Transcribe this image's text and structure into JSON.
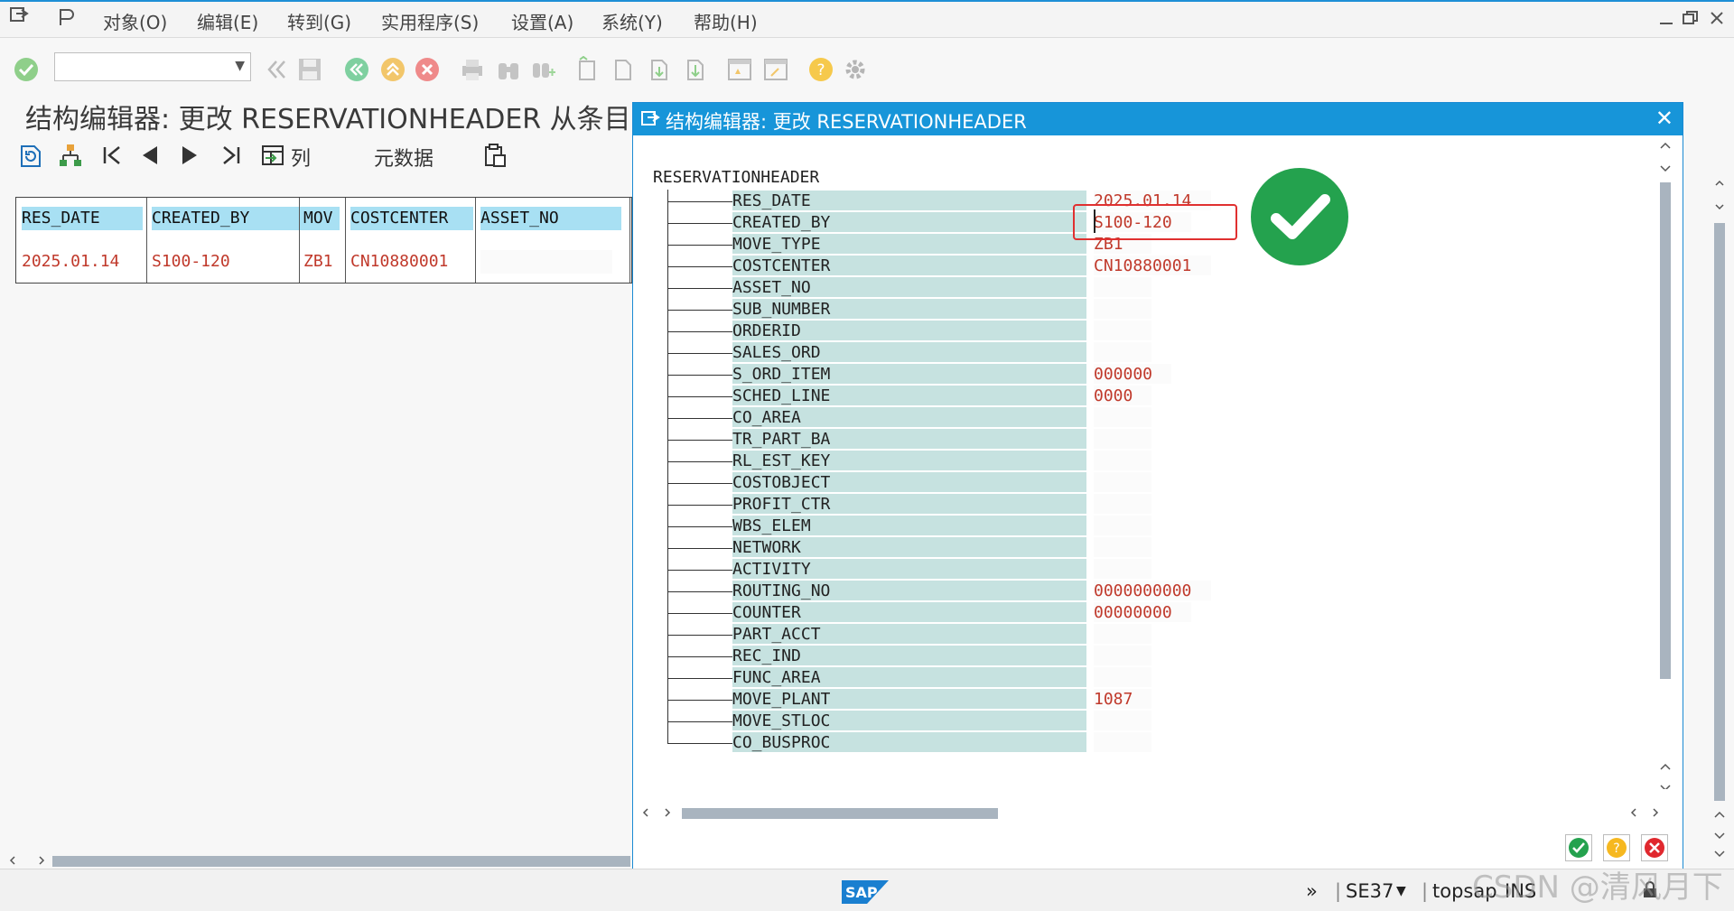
{
  "menubar": {
    "items": [
      "对象(O)",
      "编辑(E)",
      "转到(G)",
      "实用程序(S)",
      "设置(A)",
      "系统(Y)",
      "帮助(H)"
    ]
  },
  "page": {
    "title": "结构编辑器: 更改 RESERVATIONHEADER 从条目"
  },
  "app_toolbar": {
    "columns_label": "列",
    "metadata_label": "元数据"
  },
  "grid": {
    "columns": [
      "RES_DATE",
      "CREATED_BY",
      "MOV",
      "COSTCENTER",
      "ASSET_NO"
    ],
    "row": [
      "2025.01.14",
      "S100-120",
      "ZB1",
      "CN10880001",
      ""
    ]
  },
  "dialog": {
    "title": "结构编辑器: 更改 RESERVATIONHEADER",
    "root": "RESERVATIONHEADER",
    "fields": [
      {
        "name": "RES_DATE",
        "value": "2025.01.14"
      },
      {
        "name": "CREATED_BY",
        "value": "S100-120"
      },
      {
        "name": "MOVE_TYPE",
        "value": "ZB1"
      },
      {
        "name": "COSTCENTER",
        "value": "CN10880001"
      },
      {
        "name": "ASSET_NO",
        "value": ""
      },
      {
        "name": "SUB_NUMBER",
        "value": ""
      },
      {
        "name": "ORDERID",
        "value": ""
      },
      {
        "name": "SALES_ORD",
        "value": ""
      },
      {
        "name": "S_ORD_ITEM",
        "value": "000000"
      },
      {
        "name": "SCHED_LINE",
        "value": "0000"
      },
      {
        "name": "CO_AREA",
        "value": ""
      },
      {
        "name": "TR_PART_BA",
        "value": ""
      },
      {
        "name": "RL_EST_KEY",
        "value": ""
      },
      {
        "name": "COSTOBJECT",
        "value": ""
      },
      {
        "name": "PROFIT_CTR",
        "value": ""
      },
      {
        "name": "WBS_ELEM",
        "value": ""
      },
      {
        "name": "NETWORK",
        "value": ""
      },
      {
        "name": "ACTIVITY",
        "value": ""
      },
      {
        "name": "ROUTING_NO",
        "value": "0000000000"
      },
      {
        "name": "COUNTER",
        "value": "00000000"
      },
      {
        "name": "PART_ACCT",
        "value": ""
      },
      {
        "name": "REC_IND",
        "value": ""
      },
      {
        "name": "FUNC_AREA",
        "value": ""
      },
      {
        "name": "MOVE_PLANT",
        "value": "1087"
      },
      {
        "name": "MOVE_STLOC",
        "value": ""
      },
      {
        "name": "CO_BUSPROC",
        "value": ""
      }
    ]
  },
  "statusbar": {
    "tcode": "SE37",
    "server": "topsap",
    "mode": "INS",
    "logo": "SAP"
  },
  "watermark": "CSDN @清风月下",
  "colors": {
    "accent": "#1795d9",
    "header_cell": "#a8e0f3",
    "value_red": "#c0392b",
    "label_bg": "#c6e2e0",
    "success": "#24a24e"
  }
}
